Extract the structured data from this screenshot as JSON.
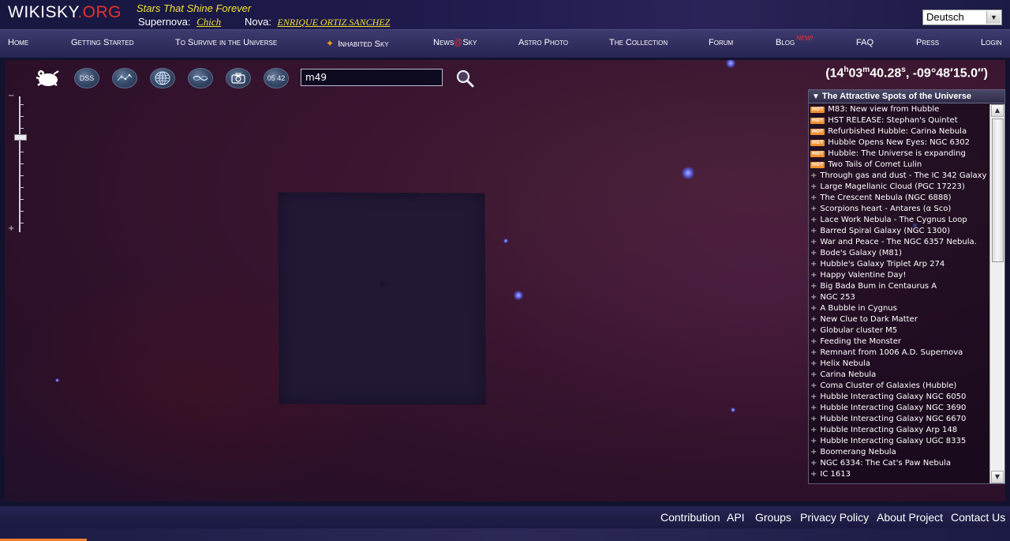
{
  "header": {
    "logo_main": "WIKISKY",
    "logo_tld": ".ORG",
    "tagline": "Stars That Shine Forever",
    "supernova_label": "Supernova:",
    "supernova_value": "Chich",
    "nova_label": "Nova:",
    "nova_value": "ENRIQUE ORTIZ SANCHEZ",
    "language": "Deutsch"
  },
  "nav": {
    "items": [
      {
        "label": "Home"
      },
      {
        "label": "Getting Started"
      },
      {
        "label": "To Survive in the Universe"
      },
      {
        "label": "Inhabited Sky"
      },
      {
        "label": "News",
        "suffix": "Sky"
      },
      {
        "label": "Astro Photo"
      },
      {
        "label": "The Collection"
      },
      {
        "label": "Forum"
      },
      {
        "label": "Blog",
        "badge": "NEW!"
      },
      {
        "label": "FAQ"
      },
      {
        "label": "Press"
      },
      {
        "label": "Login"
      }
    ]
  },
  "toolbar": {
    "dss_label": "DSS",
    "time_label": "05 42",
    "search_value": "m49"
  },
  "coords": {
    "ra_h": "14",
    "ra_m": "03",
    "ra_s": "40.28",
    "dec": "-09°48′15.0″"
  },
  "spots": {
    "title": "The Attractive Spots of the Universe",
    "hot_label": "HOT",
    "items": [
      {
        "label": "M83: New view from Hubble",
        "hot": true
      },
      {
        "label": "HST RELEASE: Stephan's Quintet",
        "hot": true
      },
      {
        "label": "Refurbished Hubble: Carina Nebula",
        "hot": true
      },
      {
        "label": "Hubble Opens New Eyes: NGC 6302",
        "hot": true
      },
      {
        "label": "Hubble: The Universe is expanding",
        "hot": true
      },
      {
        "label": "Two Tails of Comet Lulin",
        "hot": true
      },
      {
        "label": "Through gas and dust - The IC 342 Galaxy",
        "hot": false
      },
      {
        "label": "Large Magellanic Cloud (PGC 17223)",
        "hot": false
      },
      {
        "label": "The Crescent Nebula (NGC 6888)",
        "hot": false
      },
      {
        "label": "Scorpions heart - Antares (α Sco)",
        "hot": false
      },
      {
        "label": "Lace Work Nebula - The Cygnus Loop",
        "hot": false
      },
      {
        "label": "Barred Spiral Galaxy (NGC 1300)",
        "hot": false
      },
      {
        "label": "War and Peace - The NGC 6357 Nebula.",
        "hot": false
      },
      {
        "label": "Bode's Galaxy (M81)",
        "hot": false
      },
      {
        "label": "Hubble's Galaxy Triplet Arp 274",
        "hot": false
      },
      {
        "label": "Happy Valentine Day!",
        "hot": false
      },
      {
        "label": "Big Bada Bum in Centaurus A",
        "hot": false
      },
      {
        "label": "NGC 253",
        "hot": false
      },
      {
        "label": "A Bubble in Cygnus",
        "hot": false
      },
      {
        "label": "New Clue to Dark Matter",
        "hot": false
      },
      {
        "label": "Globular cluster M5",
        "hot": false
      },
      {
        "label": "Feeding the Monster",
        "hot": false
      },
      {
        "label": "Remnant from 1006 A.D. Supernova",
        "hot": false
      },
      {
        "label": "Helix Nebula",
        "hot": false
      },
      {
        "label": "Carina Nebula",
        "hot": false
      },
      {
        "label": "Coma Cluster of Galaxies (Hubble)",
        "hot": false
      },
      {
        "label": "Hubble Interacting Galaxy NGC 6050",
        "hot": false
      },
      {
        "label": "Hubble Interacting Galaxy NGC 3690",
        "hot": false
      },
      {
        "label": "Hubble Interacting Galaxy NGC 6670",
        "hot": false
      },
      {
        "label": "Hubble Interacting Galaxy Arp 148",
        "hot": false
      },
      {
        "label": "Hubble Interacting Galaxy UGC 8335",
        "hot": false
      },
      {
        "label": "Boomerang Nebula",
        "hot": false
      },
      {
        "label": "NGC 6334: The Cat's Paw Nebula",
        "hot": false
      },
      {
        "label": "IC 1613",
        "hot": false
      }
    ]
  },
  "footer": {
    "links": [
      "Contribution",
      "API",
      "Groups",
      "Privacy Policy",
      "About Project",
      "Contact Us"
    ]
  },
  "colors": {
    "accent_red": "#e8302a",
    "accent_yellow": "#f0e030",
    "hot_badge": "#f09030",
    "nav_bg": "#2e2c5e"
  }
}
